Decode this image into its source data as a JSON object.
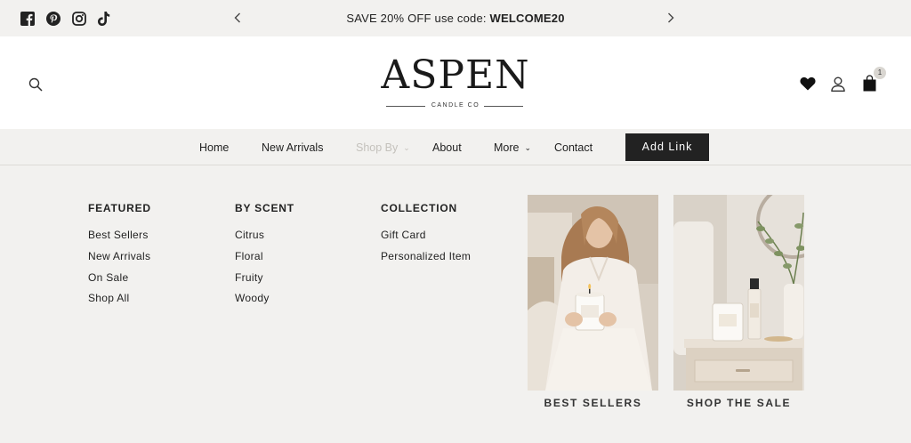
{
  "announcement": {
    "text_prefix": "SAVE 20% OFF use code: ",
    "code": "WELCOME20",
    "prev_icon": "chevron-left-icon",
    "next_icon": "chevron-right-icon"
  },
  "social": [
    "facebook-icon",
    "pinterest-icon",
    "instagram-icon",
    "tiktok-icon"
  ],
  "brand": {
    "name": "ASPEN",
    "tagline": "CANDLE CO"
  },
  "header_icons": {
    "search": "search-icon",
    "wishlist": "heart-icon",
    "account": "user-icon",
    "cart": "bag-icon",
    "cart_count": "1"
  },
  "nav": {
    "items": [
      {
        "label": "Home"
      },
      {
        "label": "New Arrivals"
      },
      {
        "label": "Shop By",
        "has_dropdown": true,
        "active": true
      },
      {
        "label": "About"
      },
      {
        "label": "More",
        "has_dropdown": true
      },
      {
        "label": "Contact"
      }
    ],
    "cta": "Add Link"
  },
  "mega_menu": {
    "columns": [
      {
        "heading": "FEATURED",
        "links": [
          "Best Sellers",
          "New Arrivals",
          "On Sale",
          "Shop All"
        ]
      },
      {
        "heading": "BY SCENT",
        "links": [
          "Citrus",
          "Floral",
          "Fruity",
          "Woody"
        ]
      },
      {
        "heading": "COLLECTION",
        "links": [
          "Gift Card",
          "Personalized Item"
        ]
      }
    ],
    "promos": [
      {
        "caption": "BEST SELLERS"
      },
      {
        "caption": "SHOP THE SALE"
      }
    ]
  },
  "colors": {
    "background": "#f2f1ef",
    "header_bg": "#ffffff",
    "button_bg": "#222222",
    "nav_dim": "#c4c1bc"
  }
}
